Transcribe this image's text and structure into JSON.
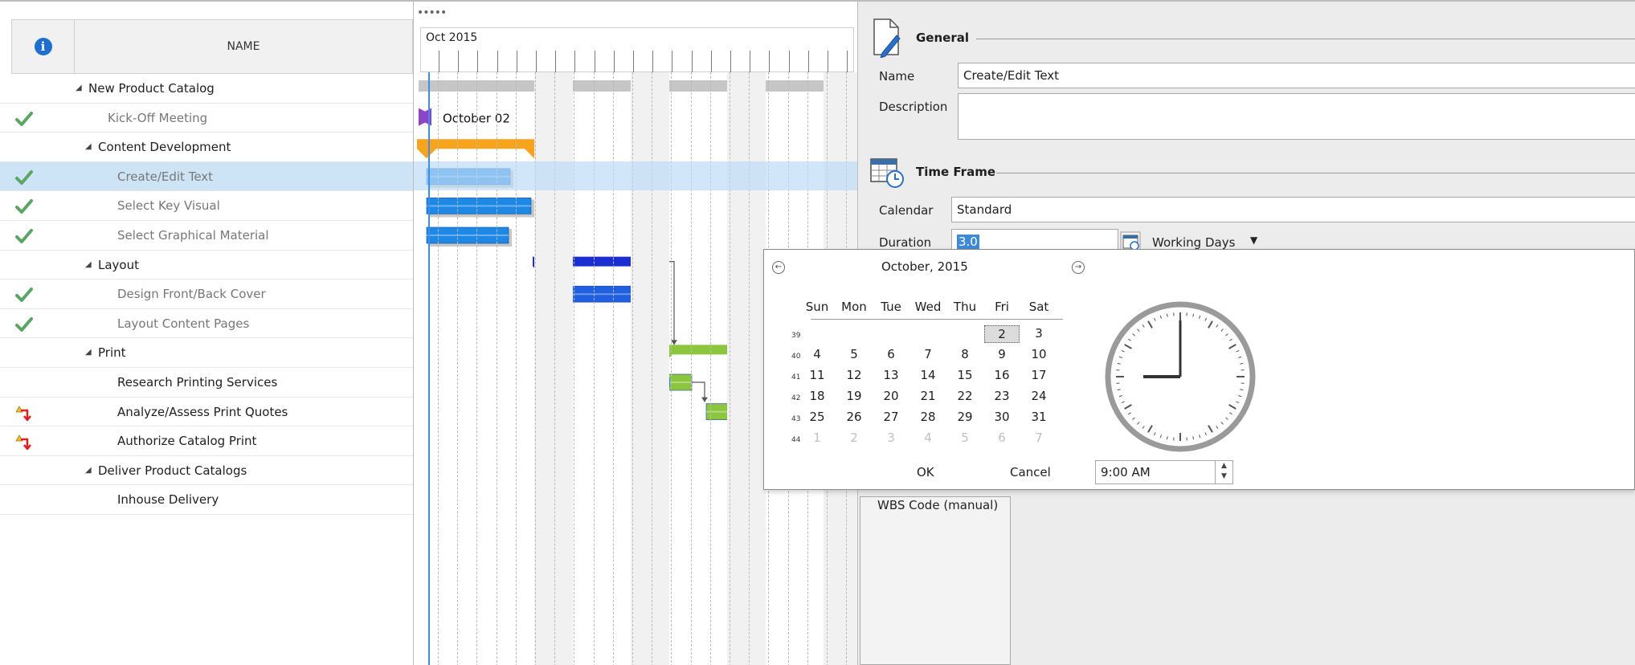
{
  "grid": {
    "name_header": "NAME",
    "rows": [
      {
        "name": "New Product Catalog",
        "level": 0,
        "group": true,
        "status": ""
      },
      {
        "name": "Kick-Off Meeting",
        "level": 1,
        "group": false,
        "status": "done"
      },
      {
        "name": "Content Development",
        "level": 1,
        "group": true,
        "status": ""
      },
      {
        "name": "Create/Edit Text",
        "level": 2,
        "group": false,
        "status": "done",
        "selected": true
      },
      {
        "name": "Select Key Visual",
        "level": 2,
        "group": false,
        "status": "done"
      },
      {
        "name": "Select Graphical Material",
        "level": 2,
        "group": false,
        "status": "done"
      },
      {
        "name": "Layout",
        "level": 1,
        "group": true,
        "status": ""
      },
      {
        "name": "Design Front/Back Cover",
        "level": 2,
        "group": false,
        "status": "done"
      },
      {
        "name": "Layout Content Pages",
        "level": 2,
        "group": false,
        "status": "done"
      },
      {
        "name": "Print",
        "level": 1,
        "group": true,
        "status": ""
      },
      {
        "name": "Research Printing Services",
        "level": 2,
        "group": false,
        "status": ""
      },
      {
        "name": "Analyze/Assess Print Quotes",
        "level": 2,
        "group": false,
        "status": "warning"
      },
      {
        "name": "Authorize Catalog Print",
        "level": 2,
        "group": false,
        "status": "warning"
      },
      {
        "name": "Deliver Product Catalogs",
        "level": 1,
        "group": true,
        "status": ""
      },
      {
        "name": "Inhouse Delivery",
        "level": 2,
        "group": false,
        "status": ""
      }
    ]
  },
  "gantt": {
    "grip": "•••••",
    "month": "Oct 2015",
    "milestone_label": "October 02",
    "colors": {
      "summary": "#c6c6c6",
      "content": "#f7a31c",
      "layout": "#1b2fd0",
      "print": "#8cc63f",
      "task": "#1e88e5",
      "milestone": "#8e44c8",
      "delivery": "#f5c518"
    }
  },
  "props": {
    "general_title": "General",
    "name_label": "Name",
    "name_value": "Create/Edit Text",
    "description_label": "Description",
    "description_value": "",
    "timeframe_title": "Time Frame",
    "calendar_label": "Calendar",
    "calendar_value": "Standard",
    "duration_label": "Duration",
    "duration_value": "3.0",
    "duration_unit": "Working Days",
    "wbs_tab": "WBS Code (manual)"
  },
  "picker": {
    "month_title": "October, 2015",
    "days_of_week": [
      "Sun",
      "Mon",
      "Tue",
      "Wed",
      "Thu",
      "Fri",
      "Sat"
    ],
    "week_numbers": [
      "39",
      "40",
      "41",
      "42",
      "43",
      "44"
    ],
    "weeks": [
      [
        "",
        "",
        "",
        "",
        "",
        "2",
        "3"
      ],
      [
        "4",
        "5",
        "6",
        "7",
        "8",
        "9",
        "10"
      ],
      [
        "11",
        "12",
        "13",
        "14",
        "15",
        "16",
        "17"
      ],
      [
        "18",
        "19",
        "20",
        "21",
        "22",
        "23",
        "24"
      ],
      [
        "25",
        "26",
        "27",
        "28",
        "29",
        "30",
        "31"
      ],
      [
        "1",
        "2",
        "3",
        "4",
        "5",
        "6",
        "7"
      ]
    ],
    "today": "2",
    "ok_label": "OK",
    "cancel_label": "Cancel",
    "time_value": "9:00 AM",
    "clock_hour": 9,
    "clock_minute": 0
  }
}
